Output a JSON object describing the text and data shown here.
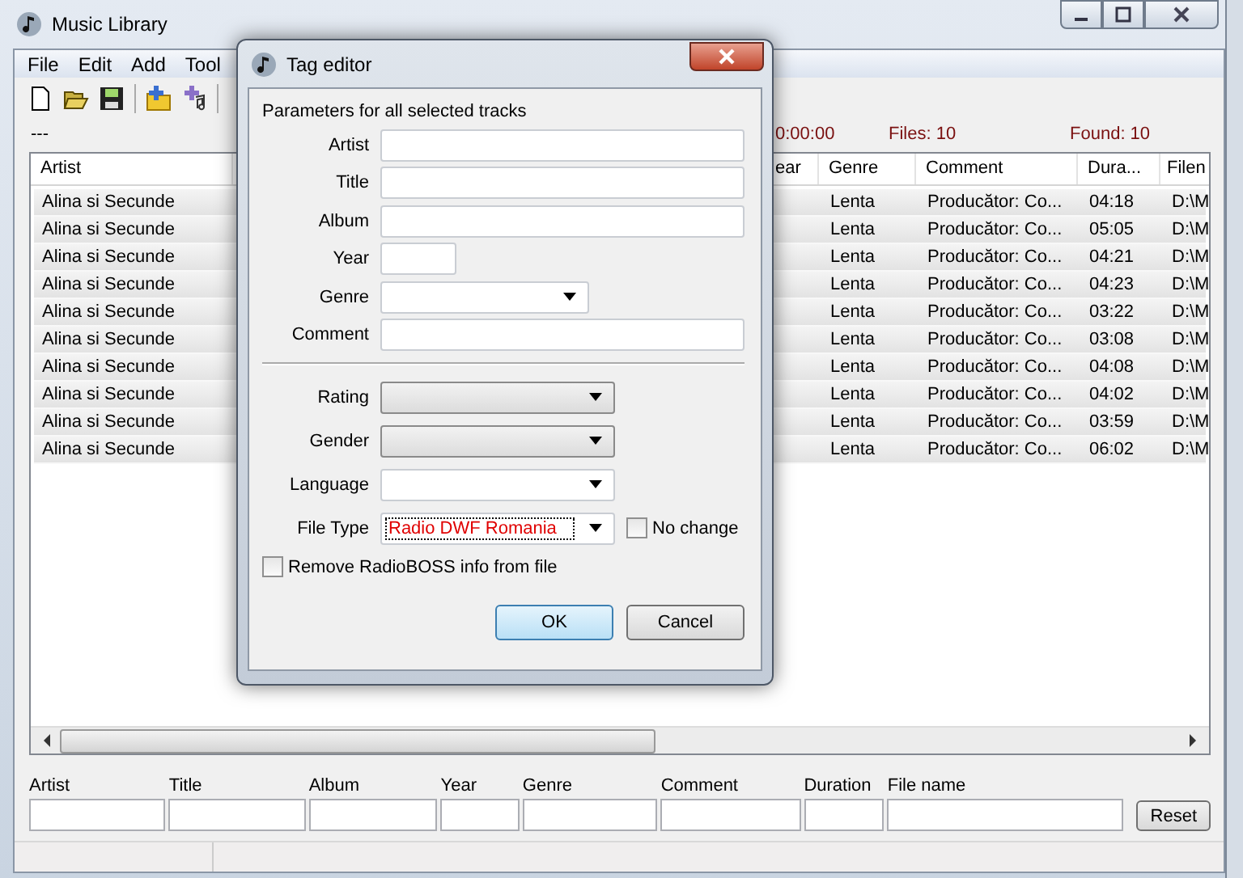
{
  "main_window": {
    "title": "Music Library",
    "menu": [
      "File",
      "Edit",
      "Add",
      "Tool"
    ],
    "summary": {
      "label": "---",
      "time": "0:00:00",
      "files": "Files: 10",
      "found": "Found: 10"
    },
    "table": {
      "columns": [
        "Artist",
        "ear",
        "Genre",
        "Comment",
        "Dura...",
        "Filen"
      ],
      "rows": [
        {
          "artist": "Alina si Secunde",
          "genre": "Lenta",
          "comment": "Producător: Co...",
          "duration": "04:18",
          "filename": "D:\\M",
          "selected": true
        },
        {
          "artist": "Alina si Secunde",
          "genre": "Lenta",
          "comment": "Producător: Co...",
          "duration": "05:05",
          "filename": "D:\\M",
          "selected": true
        },
        {
          "artist": "Alina si Secunde",
          "genre": "Lenta",
          "comment": "Producător: Co...",
          "duration": "04:21",
          "filename": "D:\\M",
          "selected": true
        },
        {
          "artist": "Alina si Secunde",
          "genre": "Lenta",
          "comment": "Producător: Co...",
          "duration": "04:23",
          "filename": "D:\\M",
          "selected": true
        },
        {
          "artist": "Alina si Secunde",
          "genre": "Lenta",
          "comment": "Producător: Co...",
          "duration": "03:22",
          "filename": "D:\\M",
          "selected": true
        },
        {
          "artist": "Alina si Secunde",
          "genre": "Lenta",
          "comment": "Producător: Co...",
          "duration": "03:08",
          "filename": "D:\\M",
          "selected": true
        },
        {
          "artist": "Alina si Secunde",
          "genre": "Lenta",
          "comment": "Producător: Co...",
          "duration": "04:08",
          "filename": "D:\\M",
          "selected": true
        },
        {
          "artist": "Alina si Secunde",
          "genre": "Lenta",
          "comment": "Producător: Co...",
          "duration": "04:02",
          "filename": "D:\\M",
          "selected": true
        },
        {
          "artist": "Alina si Secunde",
          "genre": "Lenta",
          "comment": "Producător: Co...",
          "duration": "03:59",
          "filename": "D:\\M",
          "selected": true
        },
        {
          "artist": "Alina si Secunde",
          "genre": "Lenta",
          "comment": "Producător: Co...",
          "duration": "06:02",
          "filename": "D:\\M",
          "selected": true
        }
      ]
    },
    "filters": [
      "Artist",
      "Title",
      "Album",
      "Year",
      "Genre",
      "Comment",
      "Duration",
      "File name"
    ],
    "reset_button": "Reset"
  },
  "dialog": {
    "title": "Tag editor",
    "heading": "Parameters for all selected tracks",
    "fields": [
      {
        "label": "Artist",
        "kind": "text"
      },
      {
        "label": "Title",
        "kind": "text"
      },
      {
        "label": "Album",
        "kind": "text"
      },
      {
        "label": "Year",
        "kind": "text"
      },
      {
        "label": "Genre",
        "kind": "combo",
        "disabled": false
      }
    ],
    "comment_field": {
      "label": "Comment",
      "kind": "text"
    },
    "extra_fields": [
      {
        "label": "Rating",
        "kind": "combo",
        "disabled": true
      },
      {
        "label": "Gender",
        "kind": "combo",
        "disabled": true
      },
      {
        "label": "Language",
        "kind": "combo",
        "disabled": false
      },
      {
        "label": "File Type",
        "kind": "combo",
        "disabled": false,
        "value": "Radio DWF Romania",
        "no_change": {
          "label": "No change",
          "checked": false
        }
      }
    ],
    "remove_info": {
      "label": "Remove RadioBOSS info from file",
      "checked": false
    },
    "buttons": [
      {
        "label": "OK",
        "default": true
      },
      {
        "label": "Cancel",
        "default": false
      }
    ]
  }
}
